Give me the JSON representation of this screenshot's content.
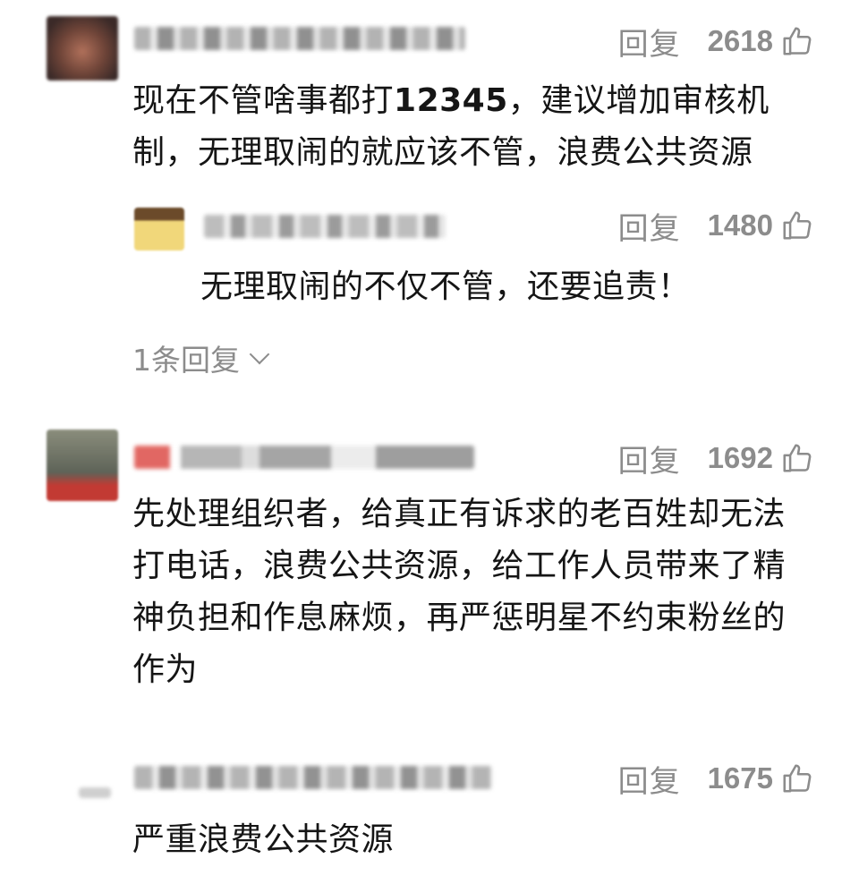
{
  "comments": [
    {
      "reply_label": "回复",
      "likes": "2618",
      "text_prefix": "现在不管啥事都打",
      "text_bold": "12345",
      "text_suffix": "，建议增加审核机制，无理取闹的就应该不管，浪费公共资源",
      "replies": [
        {
          "reply_label": "回复",
          "likes": "1480",
          "text": "无理取闹的不仅不管，还要追责！"
        }
      ],
      "expand_label": "1条回复"
    },
    {
      "reply_label": "回复",
      "likes": "1692",
      "text": "先处理组织者，给真正有诉求的老百姓却无法打电话，浪费公共资源，给工作人员带来了精神负担和作息麻烦，再严惩明星不约束粉丝的作为"
    },
    {
      "reply_label": "回复",
      "likes": "1675",
      "text": "严重浪费公共资源"
    }
  ],
  "colors": {
    "meta": "#8c8c8c",
    "text": "#151515"
  },
  "icons": {
    "like": "thumbs-up-icon",
    "expand": "chevron-down-icon"
  }
}
